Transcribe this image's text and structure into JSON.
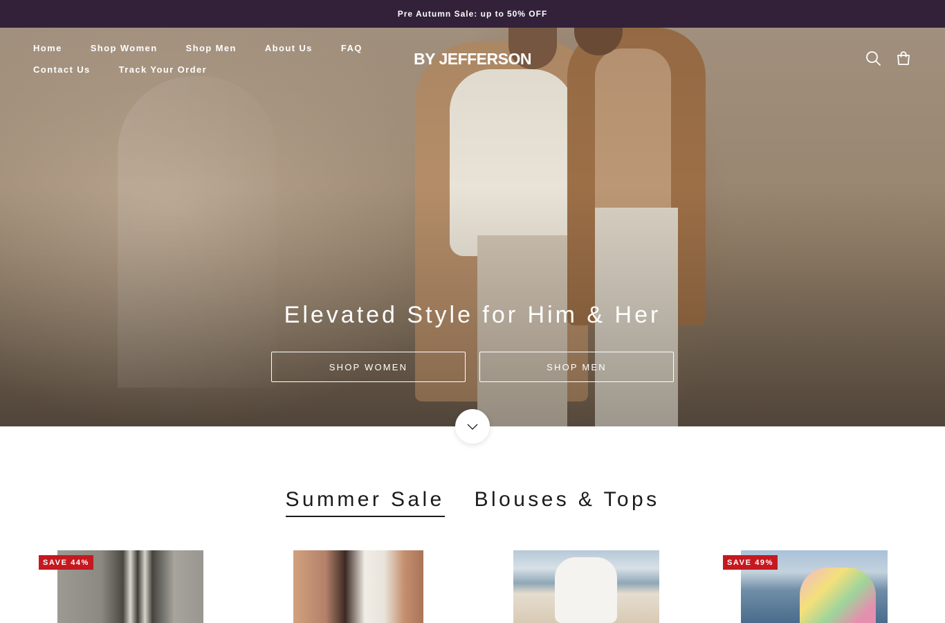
{
  "announcement": {
    "text": "Pre Autumn Sale: up to",
    "highlight": "50% OFF"
  },
  "nav": {
    "items": [
      "Home",
      "Shop Women",
      "Shop Men",
      "About Us",
      "FAQ",
      "Contact Us",
      "Track Your Order"
    ]
  },
  "logo": "BY JEFFERSON",
  "header_icons": [
    "search-icon",
    "shopping-bag-icon"
  ],
  "hero": {
    "title": "Elevated Style for Him & Her",
    "buttons": [
      "SHOP WOMEN",
      "SHOP MEN"
    ]
  },
  "tabs": {
    "items": [
      "Summer Sale",
      "Blouses & Tops"
    ],
    "active": "Summer Sale"
  },
  "products": [
    {
      "badge": "SAVE 44%"
    },
    {
      "badge": ""
    },
    {
      "badge": ""
    },
    {
      "badge": "SAVE 49%"
    }
  ],
  "colors": {
    "announcement_bg": "#33213a",
    "sale_badge": "#c51920",
    "text_dark": "#1c1b1b"
  }
}
